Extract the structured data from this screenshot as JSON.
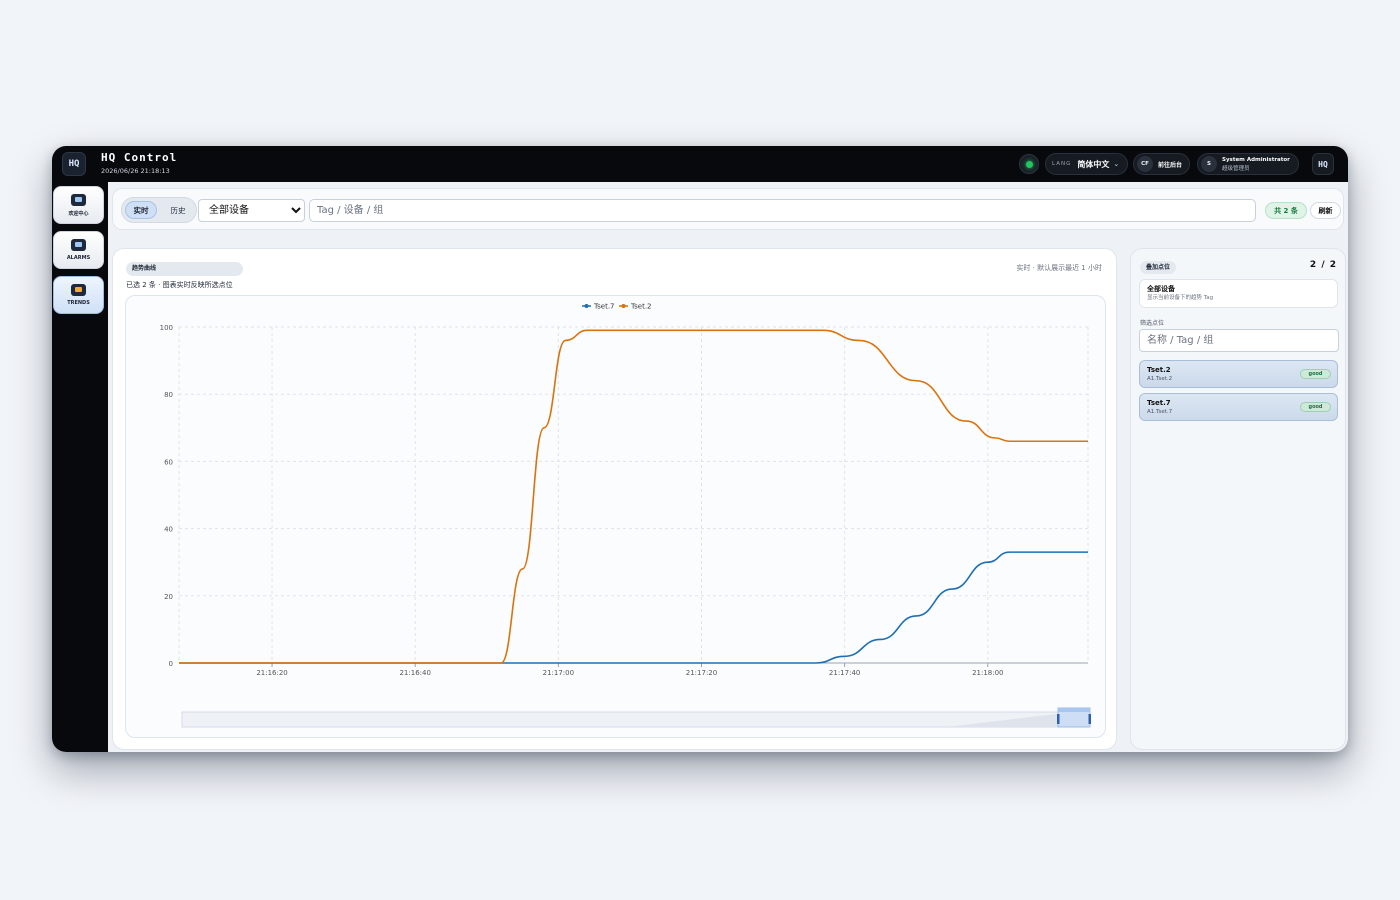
{
  "header": {
    "logo": "HQ",
    "title": "HQ Control",
    "datetime": "2026/06/26 21:18:13",
    "lang_label": "LANG",
    "lang_value": "简体中文",
    "cf_badge": "CF",
    "cf_label": "前往后台",
    "user_initial": "S",
    "user_name": "System Administrator",
    "user_role": "超级管理员",
    "brand": "HQ",
    "status_color": "#22c55e"
  },
  "sidebar": {
    "items": [
      {
        "label": "欢迎中心",
        "icon": "monitor-icon",
        "active": false
      },
      {
        "label": "ALARMS",
        "icon": "alarm-icon",
        "active": false
      },
      {
        "label": "TRENDS",
        "icon": "trend-icon",
        "active": true
      }
    ]
  },
  "toolbar": {
    "tab_realtime": "实时",
    "tab_history": "历史",
    "device_select": "全部设备",
    "search_placeholder": "Tag / 设备 / 组",
    "count": "共 2 条",
    "refresh": "刷新"
  },
  "chart_panel": {
    "tag": "趋势曲线",
    "subtitle": "已选 2 条 · 图表实时反映所选点位",
    "note": "实时 · 默认展示最近 1 小时"
  },
  "chart_data": {
    "type": "line",
    "ylim": [
      0,
      100
    ],
    "yticks": [
      0,
      20,
      40,
      60,
      80,
      100
    ],
    "xticks": [
      "21:16:20",
      "21:16:40",
      "21:17:00",
      "21:17:20",
      "21:17:40",
      "21:18:00"
    ],
    "xlim": [
      "21:16:07",
      "21:18:14"
    ],
    "grid": true,
    "legend": "top",
    "series": [
      {
        "name": "Tset.7",
        "color": "#1f6fb2",
        "points": [
          [
            "21:16:07",
            0
          ],
          [
            "21:17:36",
            0
          ],
          [
            "21:17:40",
            2
          ],
          [
            "21:17:45",
            7
          ],
          [
            "21:17:50",
            14
          ],
          [
            "21:17:55",
            22
          ],
          [
            "21:18:00",
            30
          ],
          [
            "21:18:03",
            33
          ],
          [
            "21:18:14",
            33
          ]
        ]
      },
      {
        "name": "Tset.2",
        "color": "#d9730d",
        "points": [
          [
            "21:16:07",
            0
          ],
          [
            "21:16:52",
            0
          ],
          [
            "21:16:55",
            28
          ],
          [
            "21:16:58",
            70
          ],
          [
            "21:17:01",
            96
          ],
          [
            "21:17:04",
            99
          ],
          [
            "21:17:37",
            99
          ],
          [
            "21:17:42",
            96
          ],
          [
            "21:17:50",
            84
          ],
          [
            "21:17:57",
            72
          ],
          [
            "21:18:01",
            67
          ],
          [
            "21:18:03",
            66
          ],
          [
            "21:18:14",
            66
          ]
        ]
      }
    ]
  },
  "side_panel": {
    "tag": "叠加点位",
    "count": "2 / 2",
    "all_title": "全部设备",
    "all_sub": "显示当前设备下的趋势 Tag",
    "filter_label": "筛选点位",
    "filter_placeholder": "名称 / Tag / 组",
    "tags": [
      {
        "name": "Tset.2",
        "path": "A1.Tset.2",
        "quality": "good"
      },
      {
        "name": "Tset.7",
        "path": "A1.Tset.7",
        "quality": "good"
      }
    ]
  }
}
